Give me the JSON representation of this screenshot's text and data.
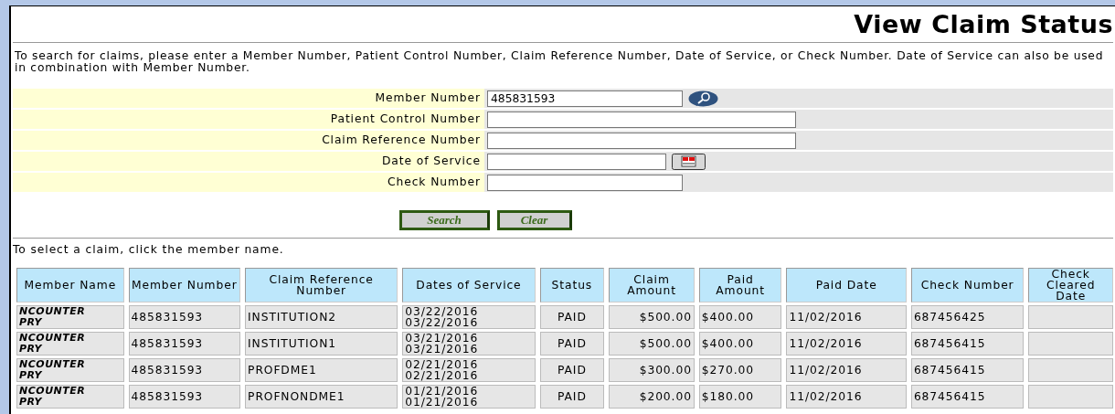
{
  "title": "View Claim Status",
  "instructions": "To search for claims, please enter a Member Number, Patient Control Number, Claim Reference Number, Date of Service, or Check Number. Date of Service can also be used in combination with Member Number.",
  "fields": [
    {
      "label": "Member Number",
      "value": "485831593",
      "kind": "search"
    },
    {
      "label": "Patient Control Number",
      "kind": "text"
    },
    {
      "label": "Claim Reference Number",
      "kind": "text"
    },
    {
      "label": "Date of Service",
      "kind": "date"
    },
    {
      "label": "Check Number",
      "kind": "short"
    }
  ],
  "buttons": [
    "Search",
    "Clear"
  ],
  "hint": "To select a claim, click the member name.",
  "table": {
    "columns": [
      "Member Name",
      "Member Number",
      "Claim Reference Number",
      "Dates of Service",
      "Status",
      "Claim Amount",
      "Paid Amount",
      "Paid Date",
      "Check Number",
      "Check Cleared Date"
    ],
    "rows": [
      {
        "member_name": "NCOUNTER PRY",
        "member_number": "485831593",
        "claim_reference": "INSTITUTION2",
        "dates": [
          "03/22/2016",
          "03/22/2016"
        ],
        "status": "PAID",
        "claim_amount": "$500.00",
        "paid_amount": "$400.00",
        "paid_date": "11/02/2016",
        "check_number": "687456425"
      },
      {
        "member_name": "NCOUNTER PRY",
        "member_number": "485831593",
        "claim_reference": "INSTITUTION1",
        "dates": [
          "03/21/2016",
          "03/21/2016"
        ],
        "status": "PAID",
        "claim_amount": "$500.00",
        "paid_amount": "$400.00",
        "paid_date": "11/02/2016",
        "check_number": "687456415"
      },
      {
        "member_name": "NCOUNTER PRY",
        "member_number": "485831593",
        "claim_reference": "PROFDME1",
        "dates": [
          "02/21/2016",
          "02/21/2016"
        ],
        "status": "PAID",
        "claim_amount": "$300.00",
        "paid_amount": "$270.00",
        "paid_date": "11/02/2016",
        "check_number": "687456415"
      },
      {
        "member_name": "NCOUNTER PRY",
        "member_number": "485831593",
        "claim_reference": "PROFNONDME1",
        "dates": [
          "01/21/2016",
          "01/21/2016"
        ],
        "status": "PAID",
        "claim_amount": "$200.00",
        "paid_amount": "$180.00",
        "paid_date": "11/02/2016",
        "check_number": "687456415"
      }
    ]
  }
}
